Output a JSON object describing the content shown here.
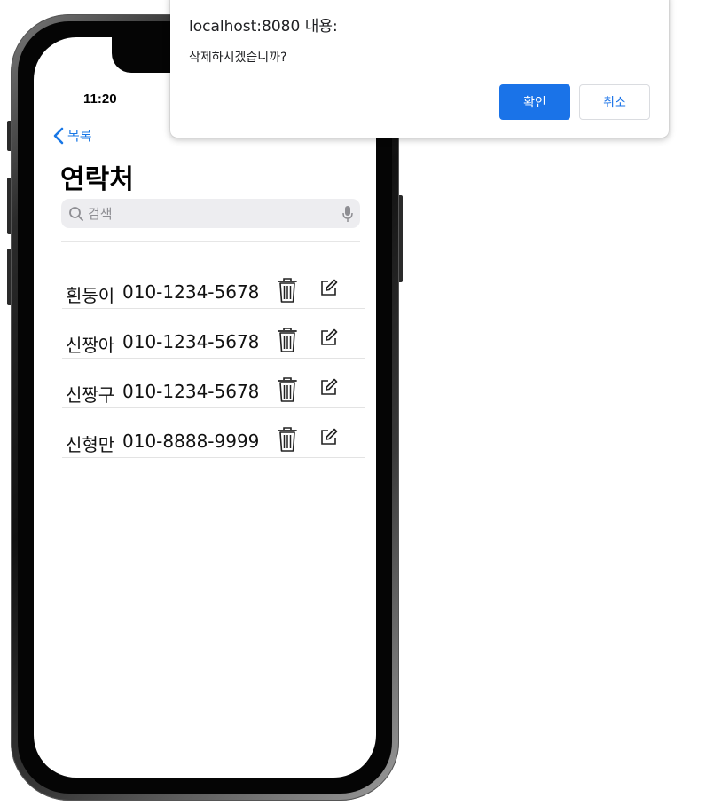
{
  "colors": {
    "accent": "#1a73e8",
    "ios_link": "#1877e6",
    "search_bg": "#ededf0"
  },
  "status_bar": {
    "time": "11:20"
  },
  "nav": {
    "back_label": "목록",
    "back_icon": "chevron-left-icon"
  },
  "page": {
    "title": "연락처"
  },
  "search": {
    "placeholder": "검색",
    "value": "",
    "icons": [
      "search-icon",
      "mic-icon"
    ]
  },
  "contacts": [
    {
      "name": "흰둥이",
      "phone": "010-1234-5678"
    },
    {
      "name": "신짱아",
      "phone": "010-1234-5678"
    },
    {
      "name": "신짱구",
      "phone": "010-1234-5678"
    },
    {
      "name": "신형만",
      "phone": "010-8888-9999"
    }
  ],
  "row_icons": [
    "trash-icon",
    "edit-icon"
  ],
  "dialog": {
    "title": "localhost:8080 내용:",
    "message": "삭제하시겠습니까?",
    "ok_label": "확인",
    "cancel_label": "취소"
  }
}
